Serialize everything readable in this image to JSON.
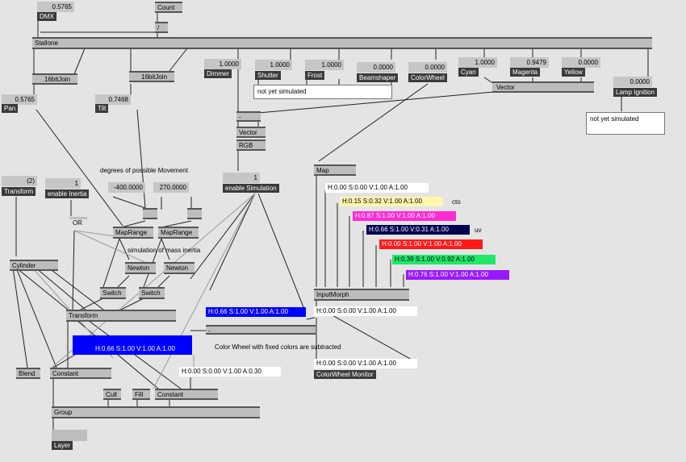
{
  "top": {
    "dmx_value": "0.5765",
    "dmx_label": "DMX",
    "count_label": "Count",
    "divide_label": "/",
    "stallone_label": "Stallone"
  },
  "joins": {
    "left_label": "16bitJoin",
    "right_label": "16bitJoin",
    "pan_value": "0.5765",
    "pan_label": "Pan",
    "tilt_value": "0.7468",
    "tilt_label": "Tilt"
  },
  "channels": [
    {
      "value": "1.0000",
      "label": "Dimmer"
    },
    {
      "value": "1.0000",
      "label": "Shutter"
    },
    {
      "value": "1.0000",
      "label": "Frost"
    },
    {
      "value": "0.0000",
      "label": "Beamshaper"
    },
    {
      "value": "0.0000",
      "label": "ColorWheel"
    },
    {
      "value": "1.0000",
      "label": "Cyan"
    },
    {
      "value": "0.9479",
      "label": "Magenta"
    },
    {
      "value": "0.0000",
      "label": "Yellow"
    }
  ],
  "vector_label": "Vector",
  "lamp": {
    "value": "0.0000",
    "label": "Lamp Ignition"
  },
  "notes": {
    "not_simulated_1": "not yet simulated",
    "not_simulated_2": "not yet simulated"
  },
  "middle": {
    "minus_label": "-",
    "vector_label": "Vector",
    "rgb_label": "RGB",
    "enable_sim_value": "1",
    "enable_sim_label": "enable Simulation",
    "degrees_text": "degrees of possible Movement",
    "range_min": "-400.0000",
    "range_max": "270.0000",
    "maprange_1": "MapRange",
    "maprange_2": "MapRange",
    "sim_text": "simulation of mass inertia",
    "newton_1": "Newton",
    "newton_2": "Newton",
    "switch_1": "Switch",
    "switch_2": "Switch",
    "or_label": "OR"
  },
  "left": {
    "transform_value": "(2)",
    "transform_label": "Transform",
    "inertia_value": "1",
    "inertia_label": "enable Inertia",
    "cylinder_label": "Cylinder",
    "transform2_label": "Transform",
    "blend_label": "Blend",
    "constant_label": "Constant",
    "cull_label": "Cull",
    "fill_label": "Fill",
    "constant2_label": "Constant",
    "group_label": "Group",
    "layer_label": "Layer"
  },
  "colors": {
    "main_blue": "H:0.66  S:1.00  V:1.00  A:1.00",
    "small_blue": "H:0.66  S:1.00  V:1.00  A:1.00",
    "white_a03": "H:0.00  S:0.00  V:1.00  A:0.30",
    "fixed_text": "Color Wheel with fixed colors are subtracted"
  },
  "wheel": {
    "map_label": "Map",
    "inputs": [
      {
        "text": "H:0.00  S:0.00  V:1.00  A:1.00",
        "bg": "#ffffff",
        "fg": "#000000",
        "note": ""
      },
      {
        "text": "H:0.15  S:0.32  V:1.00  A:1.00",
        "bg": "#fff6b0",
        "fg": "#000000",
        "note": "cto"
      },
      {
        "text": "H:0.87  S:1.00  V:1.00  A:1.00",
        "bg": "#ff2ad2",
        "fg": "#ffffff",
        "note": ""
      },
      {
        "text": "H:0.66  S:1.00  V:0.31  A:1.00",
        "bg": "#00004f",
        "fg": "#ffffff",
        "note": "uv"
      },
      {
        "text": "H:0.00  S:1.00  V:1.00  A:1.00",
        "bg": "#ff1a1a",
        "fg": "#ffffff",
        "note": ""
      },
      {
        "text": "H:0.39  S:1.00  V:0.92  A:1.00",
        "bg": "#1fe86a",
        "fg": "#000000",
        "note": ""
      },
      {
        "text": "H:0.76  S:1.00  V:1.00  A:1.00",
        "bg": "#9a18ff",
        "fg": "#ffffff",
        "note": ""
      }
    ],
    "morph_label": "InputMorph",
    "out_value": "H:0.00  S:0.00  V:1.00  A:1.00",
    "monitor_value": "H:0.00  S:0.00  V:1.00  A:1.00",
    "monitor_label": "ColorWheel Monitor"
  },
  "accent": {
    "blue": "#0000ff",
    "node_gray": "#a9a9a9",
    "label_dark": "#3b3b3b"
  }
}
